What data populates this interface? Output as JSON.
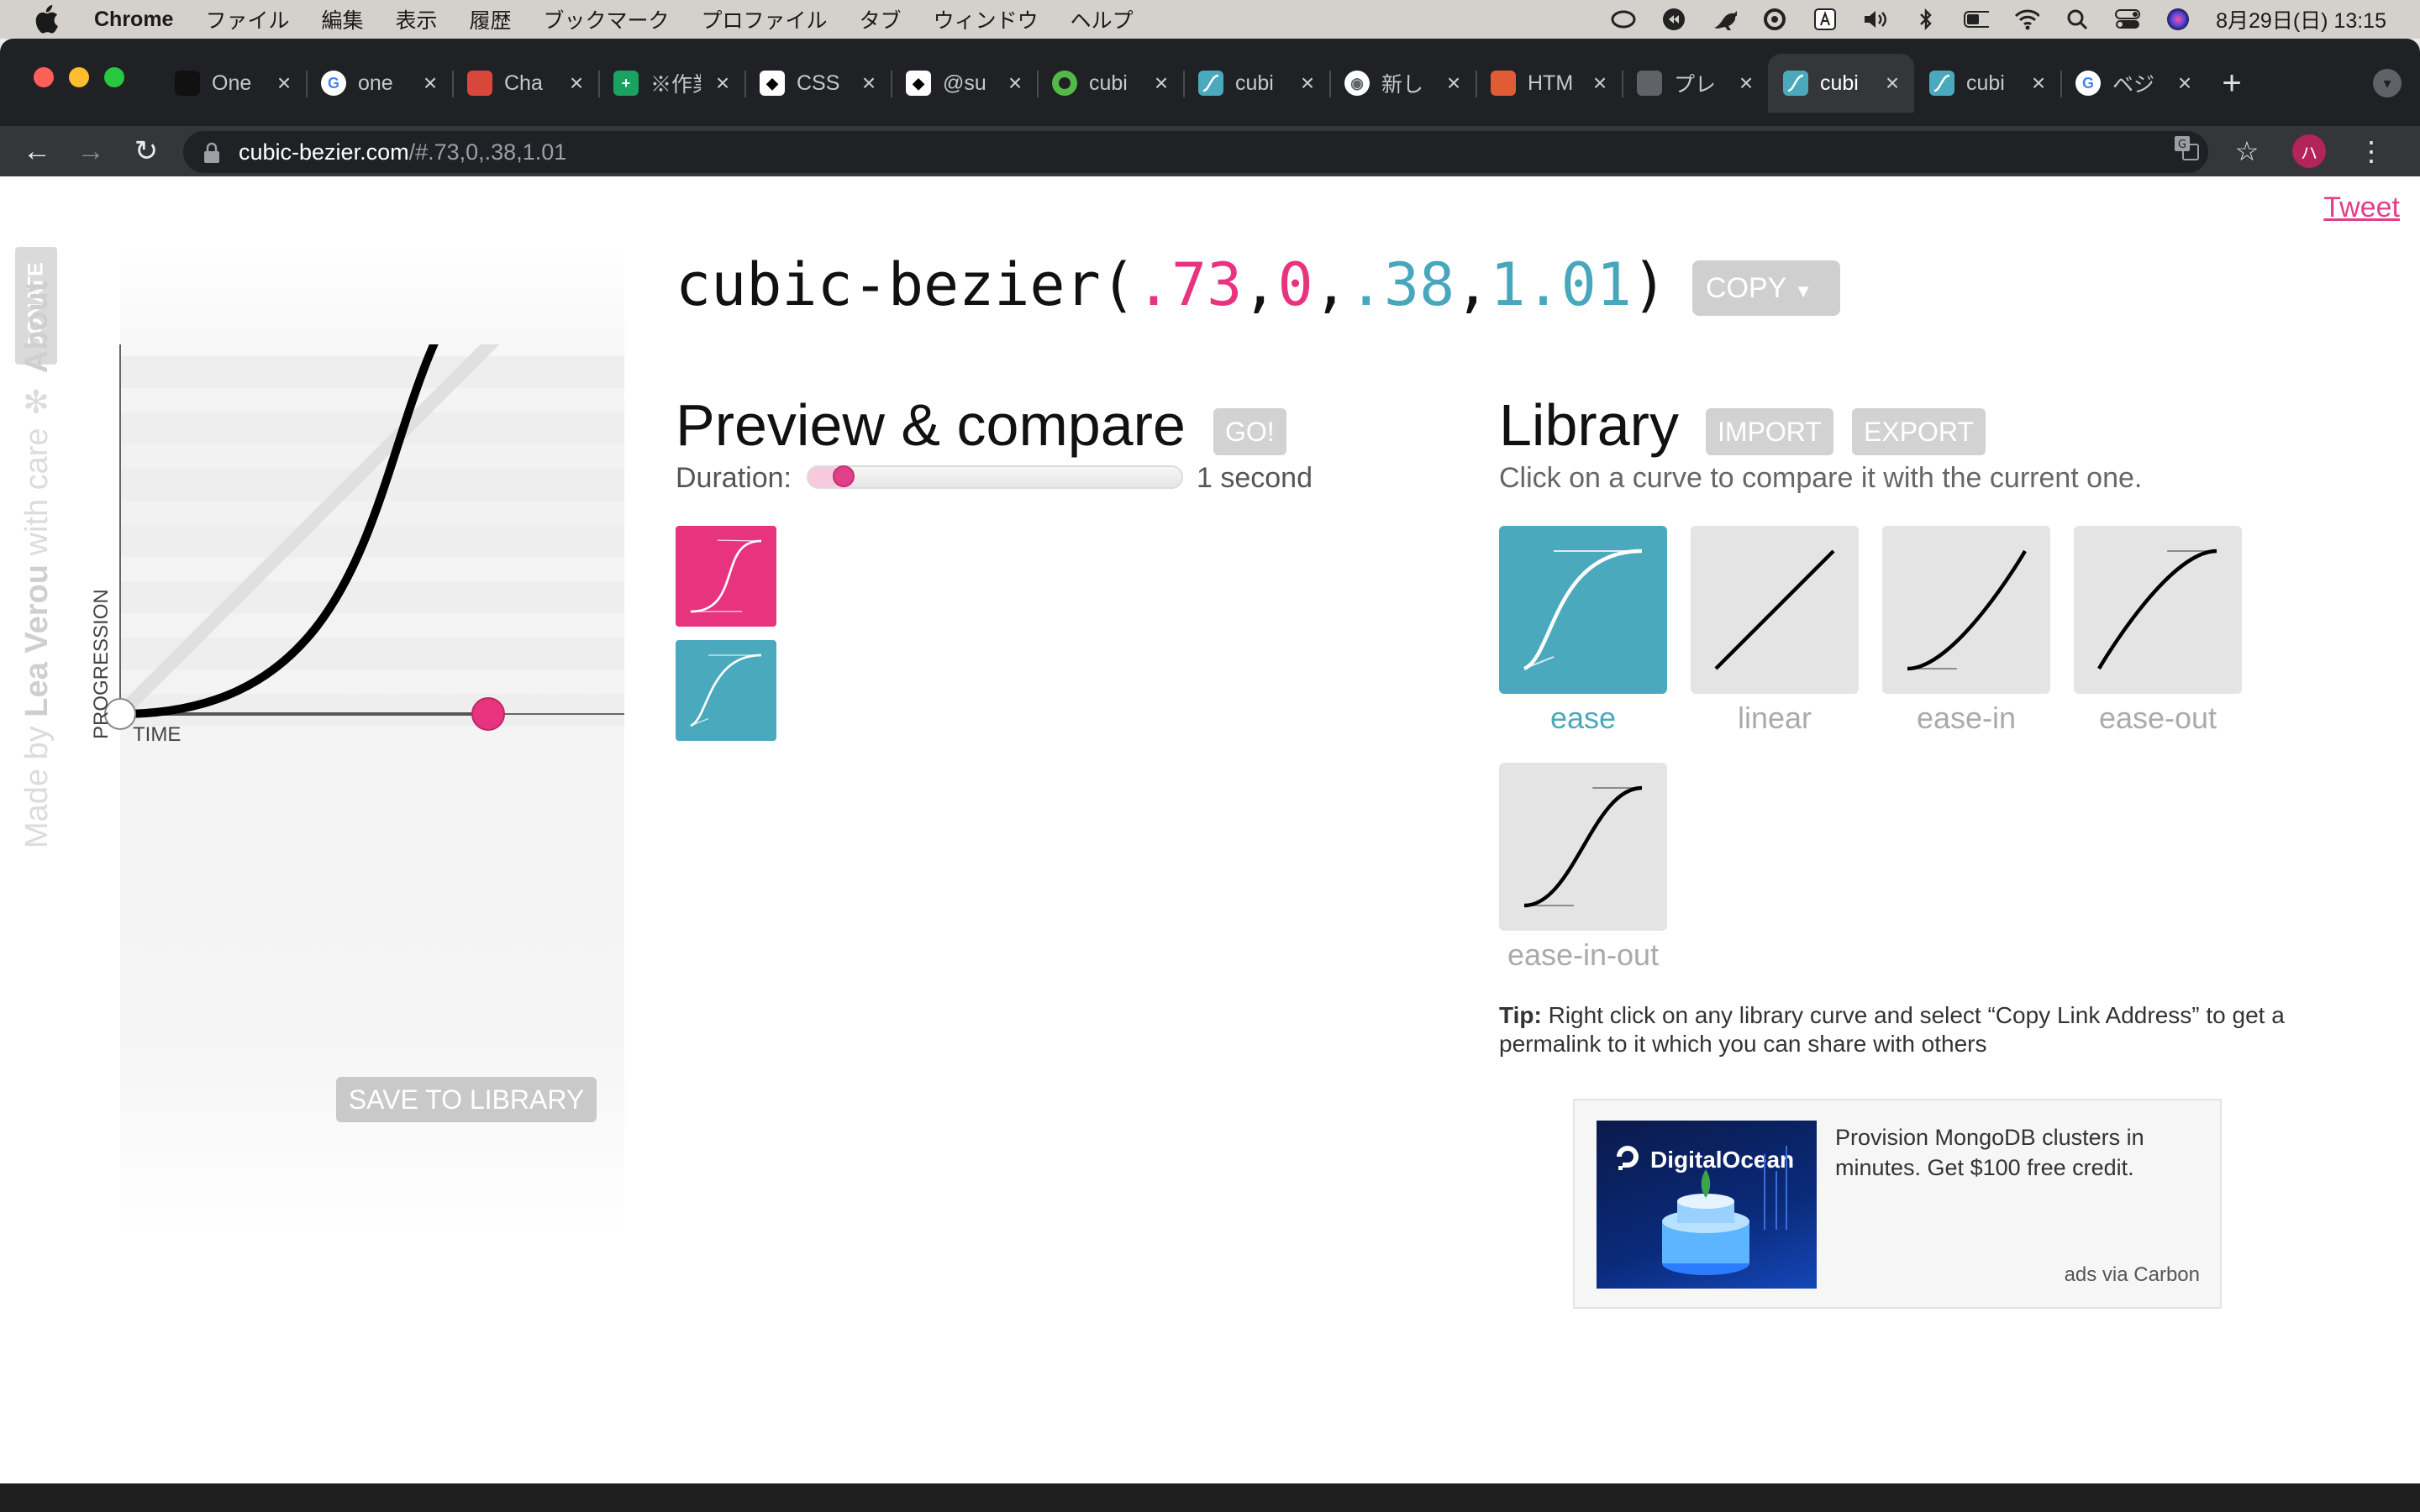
{
  "menubar": {
    "app": "Chrome",
    "items": [
      "ファイル",
      "編集",
      "表示",
      "履歴",
      "ブックマーク",
      "プロファイル",
      "タブ",
      "ウィンドウ",
      "ヘルプ"
    ],
    "clock": "8月29日(日) 13:15"
  },
  "tabs": [
    {
      "title": "One",
      "favicon_color": "#111111",
      "icon": "onefret-icon"
    },
    {
      "title": "one",
      "favicon_color": "#ffffff",
      "icon": "google-icon"
    },
    {
      "title": "Cha",
      "favicon_color": "#d9473b",
      "icon": "chart-icon"
    },
    {
      "title": "※作業",
      "favicon_color": "#1aa260",
      "icon": "sheets-icon"
    },
    {
      "title": "CSS",
      "favicon_color": "#000000",
      "icon": "notion-icon"
    },
    {
      "title": "@su",
      "favicon_color": "#000000",
      "icon": "notion-icon"
    },
    {
      "title": "cubi",
      "favicon_color": "#54b948",
      "icon": "green-ring-icon"
    },
    {
      "title": "cubi",
      "favicon_color": "#4ba9bd",
      "icon": "bezier-icon"
    },
    {
      "title": "新し",
      "favicon_color": "#ffffff",
      "icon": "chrome-icon"
    },
    {
      "title": "HTM",
      "favicon_color": "#e15b35",
      "icon": "html-icon"
    },
    {
      "title": "プレ",
      "favicon_color": "#5f6368",
      "icon": "globe-icon"
    },
    {
      "title": "cubi",
      "favicon_color": "#4ba9bd",
      "icon": "bezier-icon",
      "active": true
    },
    {
      "title": "cubi",
      "favicon_color": "#4ba9bd",
      "icon": "bezier-icon"
    },
    {
      "title": "ベジ",
      "favicon_color": "#ffffff",
      "icon": "google-icon"
    }
  ],
  "address": {
    "host": "cubic-bezier.com",
    "path": "/#.73,0,.38,1.01"
  },
  "sidebar": {
    "donate": "DONATE",
    "credit_prefix": "Made by ",
    "credit_name": "Lea Verou",
    "credit_suffix": " with care ✻ ",
    "about": "About"
  },
  "tweet": "Tweet",
  "bezier": {
    "fn_name": "cubic-bezier(",
    "p1x": ".73",
    "p1y": "0",
    "p2x": ".38",
    "p2y": "1.01",
    "close": ")",
    "comma": ",",
    "copy_label": "COPY",
    "values": [
      0.73,
      0,
      0.38,
      1.01
    ]
  },
  "editor": {
    "y_axis": "PROGRESSION",
    "x_axis": "TIME",
    "save_label": "SAVE TO LIBRARY"
  },
  "preview": {
    "heading": "Preview & compare",
    "go_label": "GO!",
    "duration_label": "Duration:",
    "duration_value": "1 second",
    "slider_fraction": 0.06,
    "colors": [
      "#e8347e",
      "#4ba9bd"
    ]
  },
  "library": {
    "heading": "Library",
    "import_label": "IMPORT",
    "export_label": "EXPORT",
    "subtitle": "Click on a curve to compare it with the current one.",
    "items": [
      {
        "name": "ease",
        "selected": true,
        "values": [
          0.25,
          0.1,
          0.25,
          1
        ]
      },
      {
        "name": "linear",
        "selected": false,
        "values": [
          0,
          0,
          1,
          1
        ]
      },
      {
        "name": "ease-in",
        "selected": false,
        "values": [
          0.42,
          0,
          1,
          1
        ]
      },
      {
        "name": "ease-out",
        "selected": false,
        "values": [
          0,
          0,
          0.58,
          1
        ]
      },
      {
        "name": "ease-in-out",
        "selected": false,
        "values": [
          0.42,
          0,
          0.58,
          1
        ]
      }
    ]
  },
  "tip": {
    "label": "Tip:",
    "text": " Right click on any library curve and select “Copy Link Address” to get a permalink to it which you can share with others"
  },
  "ad": {
    "brand": "DigitalOcean",
    "text": "Provision MongoDB clusters in minutes. Get $100 free credit.",
    "via": "ads via Carbon"
  }
}
